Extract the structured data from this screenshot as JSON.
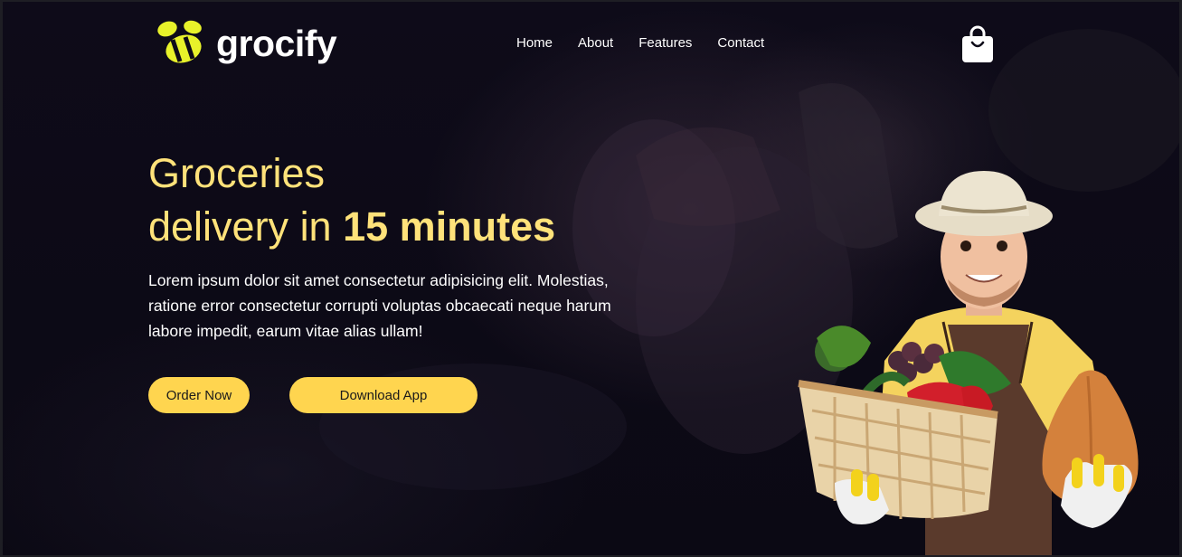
{
  "brand": {
    "name": "grocify",
    "accent": "#ffe27a",
    "logo_color": "#e8f22a"
  },
  "nav": {
    "items": [
      "Home",
      "About",
      "Features",
      "Contact"
    ]
  },
  "cart": {
    "icon": "shopping-bag-icon"
  },
  "hero": {
    "title_line1": "Groceries",
    "title_line2_prefix": "delivery in ",
    "title_line2_emphasis": "15 minutes",
    "description": "Lorem ipsum dolor sit amet consectetur adipisicing elit. Molestias, ratione error consectetur corrupti voluptas obcaecati neque harum labore impedit, earum vitae alias ullam!",
    "buttons": {
      "order": "Order Now",
      "download": "Download App"
    },
    "button_color": "#ffd54f"
  },
  "illustration": {
    "subject": "farmer-with-vegetable-basket"
  }
}
